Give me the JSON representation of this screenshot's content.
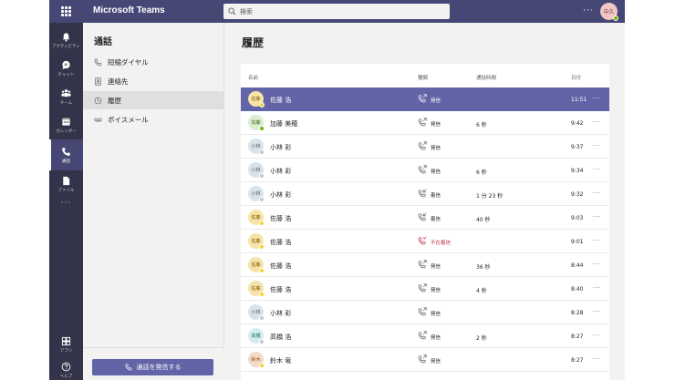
{
  "app": {
    "title": "Microsoft Teams"
  },
  "search": {
    "placeholder": "検索"
  },
  "header": {
    "more": "···",
    "avatar_initials": "中久"
  },
  "rail": {
    "items": [
      {
        "label": "アクティビティ",
        "icon": "bell-icon"
      },
      {
        "label": "チャット",
        "icon": "chat-icon"
      },
      {
        "label": "チーム",
        "icon": "teams-icon"
      },
      {
        "label": "カレンダー",
        "icon": "calendar-icon"
      },
      {
        "label": "通話",
        "icon": "phone-icon",
        "active": true
      },
      {
        "label": "ファイル",
        "icon": "file-icon"
      }
    ],
    "more": "···",
    "bottom": [
      {
        "label": "アプリ",
        "icon": "apps-icon"
      },
      {
        "label": "ヘルプ",
        "icon": "help-icon"
      }
    ]
  },
  "left_pane": {
    "title": "通話",
    "items": [
      {
        "label": "短縮ダイヤル",
        "icon": "speed-dial-icon"
      },
      {
        "label": "連絡先",
        "icon": "contacts-icon"
      },
      {
        "label": "履歴",
        "icon": "history-icon",
        "active": true
      },
      {
        "label": "ボイスメール",
        "icon": "voicemail-icon"
      }
    ],
    "make_call_label": "通話を発信する"
  },
  "main": {
    "title": "履歴",
    "columns": {
      "name": "名前",
      "type": "種類",
      "duration": "通話時間",
      "time": "日付"
    },
    "rows": [
      {
        "initials": "佐藤",
        "name": "佐藤 浩",
        "type": "発信",
        "call": "outgoing",
        "duration": "",
        "time": "11:51",
        "avatar_bg": "#f6e3a8",
        "avatar_fg": "#7a5a00",
        "status": "#f8d22a",
        "selected": true
      },
      {
        "initials": "加藤",
        "name": "加藤 美穂",
        "type": "発信",
        "call": "outgoing",
        "duration": "6 秒",
        "time": "9:42",
        "avatar_bg": "#dcecd1",
        "avatar_fg": "#3d6b1f",
        "status": "#6bb700"
      },
      {
        "initials": "小林",
        "name": "小林 彩",
        "type": "発信",
        "call": "outgoing",
        "duration": "",
        "time": "9:37",
        "avatar_bg": "#d9e4ea",
        "avatar_fg": "#45606e",
        "status": "#c8c6c4"
      },
      {
        "initials": "小林",
        "name": "小林 彩",
        "type": "発信",
        "call": "outgoing",
        "duration": "6 秒",
        "time": "9:34",
        "avatar_bg": "#d9e4ea",
        "avatar_fg": "#45606e",
        "status": "#c8c6c4"
      },
      {
        "initials": "小林",
        "name": "小林 彩",
        "type": "着信",
        "call": "incoming",
        "duration": "1 分 23 秒",
        "time": "9:32",
        "avatar_bg": "#d9e4ea",
        "avatar_fg": "#45606e",
        "status": "#c8c6c4"
      },
      {
        "initials": "佐藤",
        "name": "佐藤 浩",
        "type": "着信",
        "call": "incoming",
        "duration": "40 秒",
        "time": "9:03",
        "avatar_bg": "#f6e3a8",
        "avatar_fg": "#7a5a00",
        "status": "#f8d22a"
      },
      {
        "initials": "佐藤",
        "name": "佐藤 浩",
        "type": "不在着信",
        "call": "missed",
        "duration": "",
        "time": "9:01",
        "avatar_bg": "#f6e3a8",
        "avatar_fg": "#7a5a00",
        "status": "#f8d22a"
      },
      {
        "initials": "佐藤",
        "name": "佐藤 浩",
        "type": "発信",
        "call": "outgoing",
        "duration": "36 秒",
        "time": "8:44",
        "avatar_bg": "#f6e3a8",
        "avatar_fg": "#7a5a00",
        "status": "#f8d22a"
      },
      {
        "initials": "佐藤",
        "name": "佐藤 浩",
        "type": "発信",
        "call": "outgoing",
        "duration": "4 秒",
        "time": "8:40",
        "avatar_bg": "#f6e3a8",
        "avatar_fg": "#7a5a00",
        "status": "#f8d22a"
      },
      {
        "initials": "小林",
        "name": "小林 彩",
        "type": "発信",
        "call": "outgoing",
        "duration": "",
        "time": "8:28",
        "avatar_bg": "#d9e4ea",
        "avatar_fg": "#45606e",
        "status": "#c8c6c4"
      },
      {
        "initials": "高橋",
        "name": "高橋 浩",
        "type": "発信",
        "call": "outgoing",
        "duration": "2 秒",
        "time": "8:27",
        "avatar_bg": "#d3ecec",
        "avatar_fg": "#2b6b6b",
        "status": "#c8c6c4"
      },
      {
        "initials": "鈴木",
        "name": "鈴木 竜",
        "type": "発信",
        "call": "outgoing",
        "duration": "",
        "time": "8:27",
        "avatar_bg": "#f3d9c8",
        "avatar_fg": "#8a4a20",
        "status": "#f8d22a"
      }
    ]
  },
  "colors": {
    "brand": "#6264a7",
    "topbar": "#464775",
    "rail": "#33344a",
    "missed": "#c4314b"
  }
}
